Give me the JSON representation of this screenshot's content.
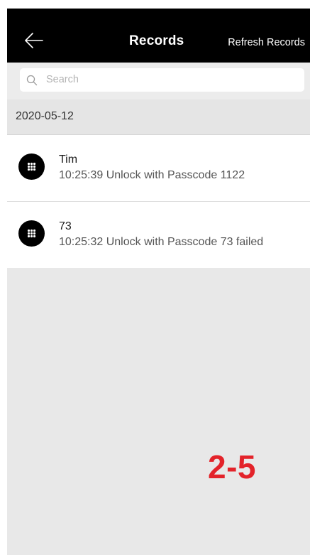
{
  "header": {
    "title": "Records",
    "action_label": "Refresh Records",
    "back_icon": "back-arrow-icon"
  },
  "search": {
    "placeholder": "Search",
    "icon": "search-icon"
  },
  "groups": [
    {
      "date": "2020-05-12",
      "records": [
        {
          "name": "Tim",
          "detail": "10:25:39 Unlock with Passcode 1122",
          "icon": "keypad-icon"
        },
        {
          "name": "73",
          "detail": "10:25:32 Unlock with Passcode 73 failed",
          "icon": "keypad-icon"
        }
      ]
    }
  ],
  "annotation": {
    "label": "2-5",
    "color": "#e3232a"
  },
  "colors": {
    "nav_bg": "#000000",
    "page_bg": "#e8e8e8",
    "row_bg": "#ffffff"
  }
}
